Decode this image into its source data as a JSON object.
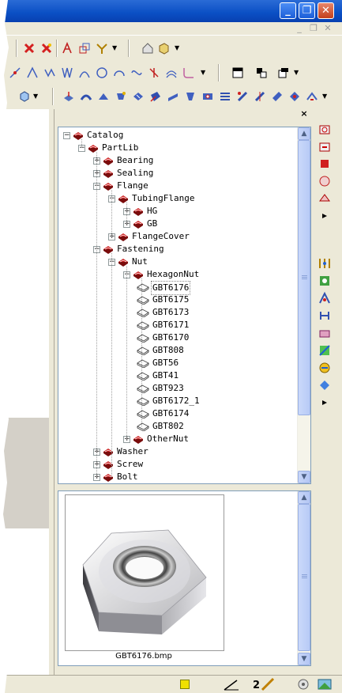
{
  "window": {
    "minimize_label": "_",
    "restore_label": "❐",
    "close_label": "✕"
  },
  "mdi": {
    "minimize_label": "_",
    "restore_label": "❐",
    "close_label": "✕"
  },
  "panel": {
    "close_label": "×"
  },
  "tree": {
    "nodes": [
      {
        "label": "Catalog",
        "expanded": true
      },
      {
        "label": "PartLib",
        "expanded": true
      },
      {
        "label": "Bearing",
        "expanded": false
      },
      {
        "label": "Sealing",
        "expanded": false
      },
      {
        "label": "Flange",
        "expanded": true
      },
      {
        "label": "TubingFlange",
        "expanded": true
      },
      {
        "label": "HG",
        "expanded": false
      },
      {
        "label": "GB",
        "expanded": false
      },
      {
        "label": "FlangeCover",
        "expanded": false
      },
      {
        "label": "Fastening",
        "expanded": true
      },
      {
        "label": "Nut",
        "expanded": true
      },
      {
        "label": "HexagonNut",
        "expanded": true
      },
      {
        "label": "GBT6176",
        "selected": true
      },
      {
        "label": "GBT6175"
      },
      {
        "label": "GBT6173"
      },
      {
        "label": "GBT6171"
      },
      {
        "label": "GBT6170"
      },
      {
        "label": "GBT808"
      },
      {
        "label": "GBT56"
      },
      {
        "label": "GBT41"
      },
      {
        "label": "GBT923"
      },
      {
        "label": "GBT6172_1"
      },
      {
        "label": "GBT6174"
      },
      {
        "label": "GBT802"
      },
      {
        "label": "OtherNut",
        "expanded": false
      },
      {
        "label": "Washer",
        "expanded": false
      },
      {
        "label": "Screw",
        "expanded": false
      },
      {
        "label": "Bolt",
        "expanded": false
      }
    ]
  },
  "preview": {
    "caption": "GBT6176.bmp"
  },
  "colors": {
    "book_red": "#cc1b1b",
    "tree_border": "#7f9db9",
    "title_blue": "#0a4fc4"
  }
}
